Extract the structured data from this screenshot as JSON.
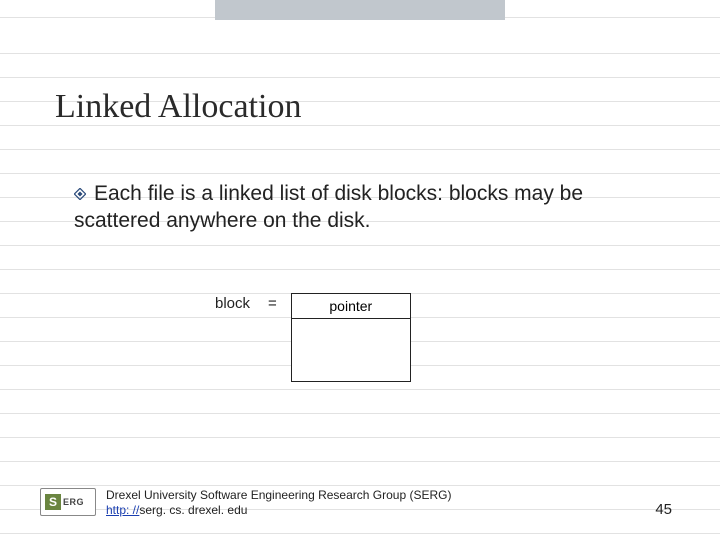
{
  "title": "Linked Allocation",
  "body_text": "Each file is a linked list of disk blocks: blocks may be scattered anywhere on the disk.",
  "block_row": {
    "lhs": "block",
    "eq": "=",
    "pointer_label": "pointer"
  },
  "footer": {
    "org": "Drexel University Software Engineering Research Group (SERG)",
    "link_scheme": "http: //",
    "link_host": "serg. cs. drexel. edu"
  },
  "page_number": "45",
  "logo": {
    "s": "S",
    "erg": "ERG"
  }
}
